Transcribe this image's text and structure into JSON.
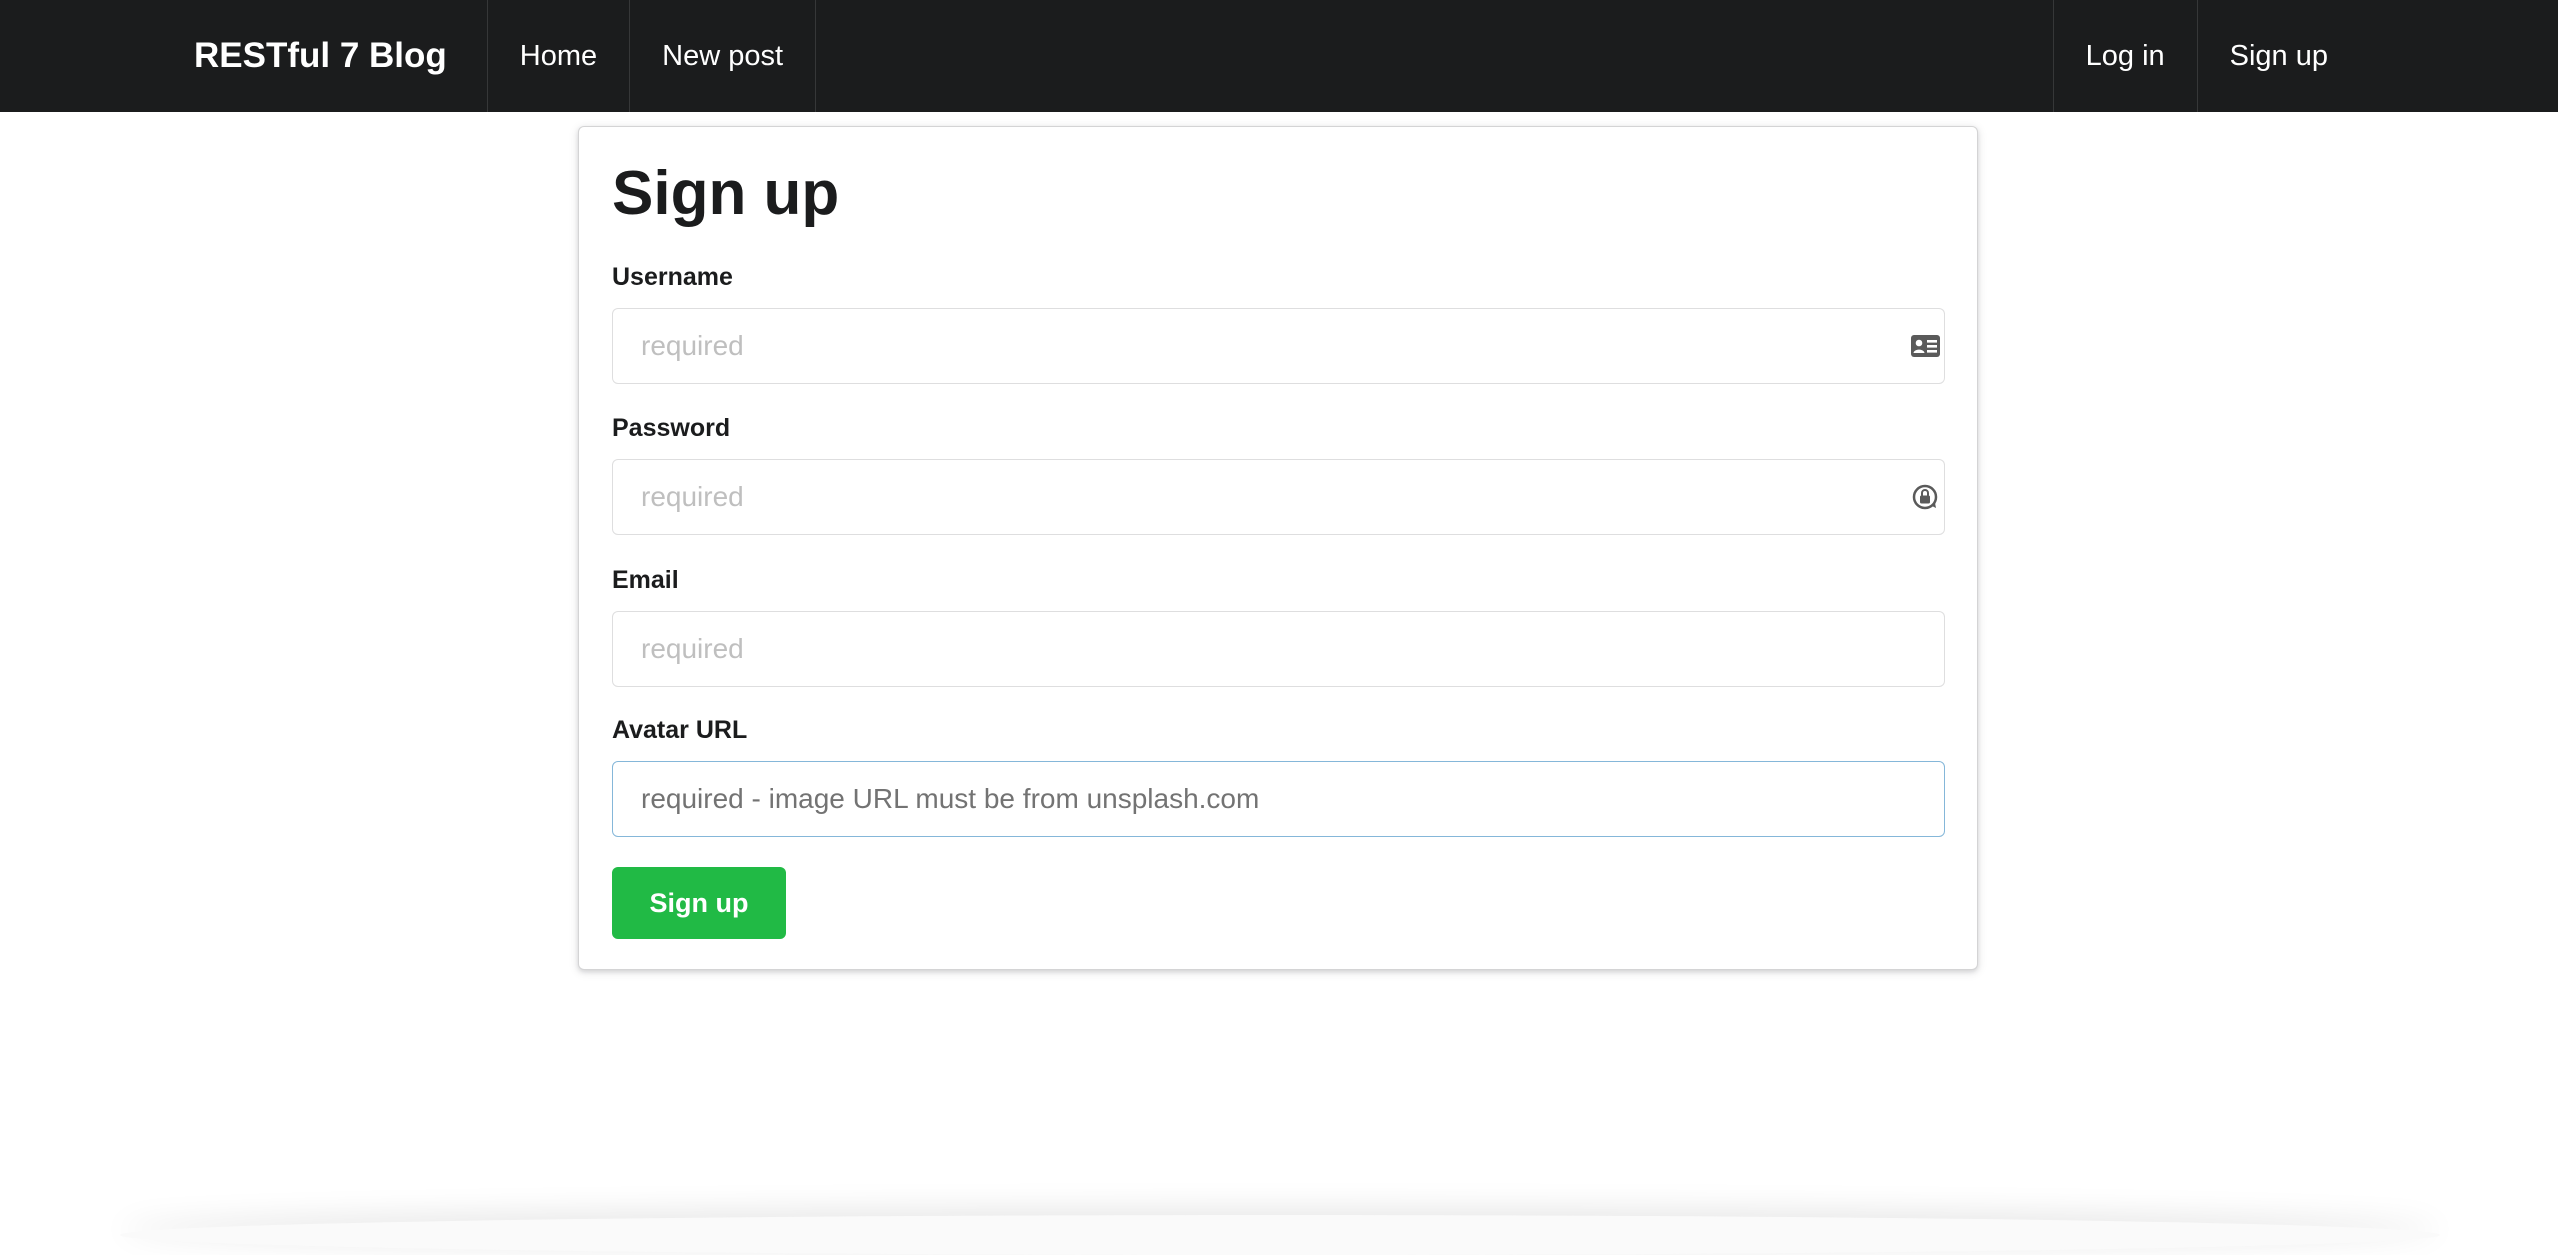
{
  "nav": {
    "brand": "RESTful 7 Blog",
    "home": "Home",
    "new_post": "New post",
    "log_in": "Log in",
    "sign_up": "Sign up"
  },
  "form": {
    "title": "Sign up",
    "username": {
      "label": "Username",
      "placeholder": "required",
      "icon": "id-card-icon"
    },
    "password": {
      "label": "Password",
      "placeholder": "required",
      "icon": "password-manager-icon"
    },
    "email": {
      "label": "Email",
      "placeholder": "required"
    },
    "avatar": {
      "label": "Avatar URL",
      "placeholder": "required - image URL must be from unsplash.com"
    },
    "submit_label": "Sign up"
  },
  "colors": {
    "navbar": "#1b1c1d",
    "submit": "#21ba45",
    "focus_border": "#85b7d9"
  }
}
